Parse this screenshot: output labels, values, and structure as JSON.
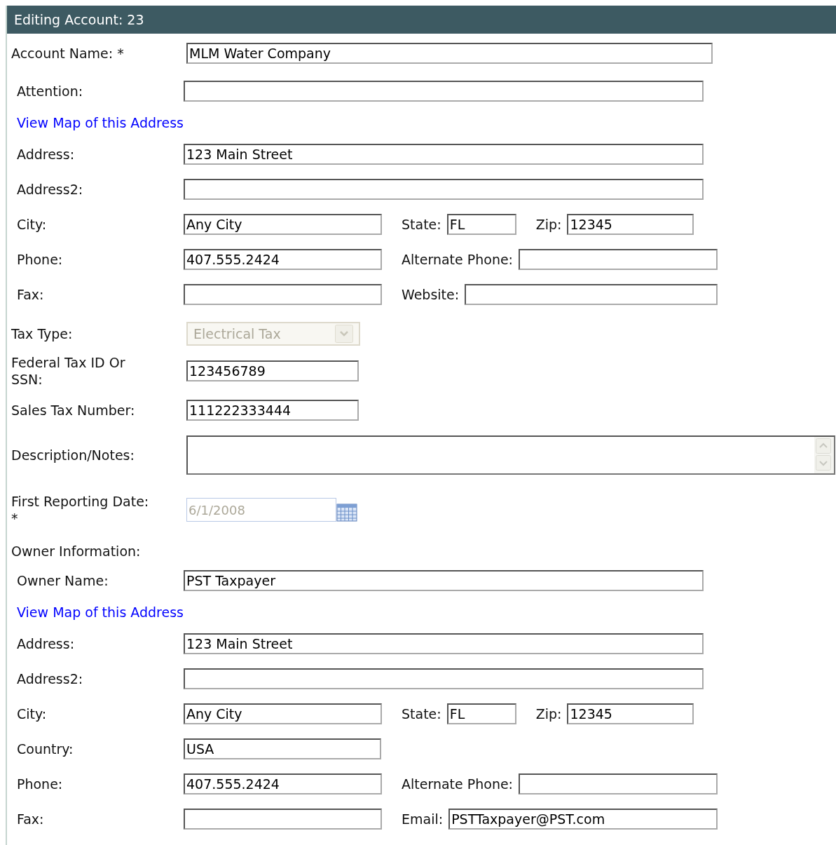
{
  "title": "Editing Account: 23",
  "sections": [
    {
      "kind": "plain",
      "rows": [
        {
          "kind": "wide",
          "label": "Account Name: *",
          "value": "MLM Water Company"
        }
      ]
    },
    {
      "kind": "inset",
      "rows": [
        {
          "kind": "wide",
          "label": "Attention:"
        },
        {
          "kind": "link",
          "text": "View Map of this Address"
        },
        {
          "kind": "wide",
          "label": "Address:",
          "value": "123 Main Street"
        },
        {
          "kind": "wide",
          "label": "Address2:"
        },
        {
          "kind": "triple",
          "label": "City:",
          "value": "Any City",
          "fields": [
            {
              "label": "State:",
              "value": "FL"
            },
            {
              "label": "Zip:",
              "value": "12345"
            }
          ]
        },
        {
          "kind": "pair",
          "label": "Phone:",
          "value": "407.555.2424",
          "fields": [
            {
              "label": "Alternate Phone:"
            }
          ]
        },
        {
          "kind": "pair",
          "label": "Fax:",
          "fields": [
            {
              "label": "Website:"
            }
          ]
        }
      ]
    },
    {
      "kind": "plain",
      "rows": [
        {
          "kind": "select",
          "label": "Tax Type:",
          "value": "Electrical Tax",
          "disabled": true
        },
        {
          "kind": "narrow",
          "label": "Federal Tax ID Or SSN:",
          "value": "123456789"
        },
        {
          "kind": "narrow",
          "label": "Sales Tax Number:",
          "value": "111222333444"
        },
        {
          "kind": "textarea",
          "label": "Description/Notes:"
        },
        {
          "kind": "date",
          "label": "First Reporting Date: *",
          "value": "6/1/2008",
          "disabled": true
        },
        {
          "kind": "heading",
          "label": "Owner Information:"
        }
      ]
    },
    {
      "kind": "inset",
      "rows": [
        {
          "kind": "wide",
          "label": "Owner Name:",
          "value": "PST Taxpayer"
        },
        {
          "kind": "link",
          "text": "View Map of this Address"
        },
        {
          "kind": "wide",
          "label": "Address:",
          "value": "123 Main Street"
        },
        {
          "kind": "wide",
          "label": "Address2:"
        },
        {
          "kind": "triple",
          "label": "City:",
          "value": "Any City",
          "fields": [
            {
              "label": "State:",
              "value": "FL"
            },
            {
              "label": "Zip:",
              "value": "12345"
            }
          ]
        },
        {
          "kind": "short",
          "label": "Country:",
          "value": "USA"
        },
        {
          "kind": "pair",
          "label": "Phone:",
          "value": "407.555.2424",
          "fields": [
            {
              "label": "Alternate Phone:"
            }
          ]
        },
        {
          "kind": "pair",
          "label": "Fax:",
          "fields": [
            {
              "label": "Email:",
              "value": "PSTTaxpayer@PST.com"
            }
          ]
        }
      ]
    }
  ]
}
